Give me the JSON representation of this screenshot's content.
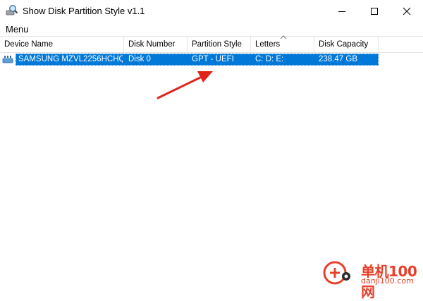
{
  "window": {
    "title": "Show Disk Partition Style v1.1",
    "icon": "disk-magnifier-icon"
  },
  "menubar": {
    "items": [
      {
        "label": "Menu"
      }
    ]
  },
  "table": {
    "columns": [
      {
        "label": "Device Name"
      },
      {
        "label": "Disk Number"
      },
      {
        "label": "Partition Style"
      },
      {
        "label": "Letters",
        "sorted": true
      },
      {
        "label": "Disk Capacity"
      }
    ],
    "rows": [
      {
        "device_name": "SAMSUNG MZVL2256HCHQ-...",
        "disk_number": "Disk 0",
        "partition_style": "GPT - UEFI",
        "letters": "C:  D:  E:",
        "disk_capacity": "238.47 GB",
        "selected": true
      }
    ]
  },
  "colors": {
    "selection": "#0078d7",
    "annotation_arrow": "#e0241b",
    "watermark": "#e8402b"
  },
  "watermark": {
    "main_text": "单机100网",
    "sub_text": "danji100.com"
  }
}
